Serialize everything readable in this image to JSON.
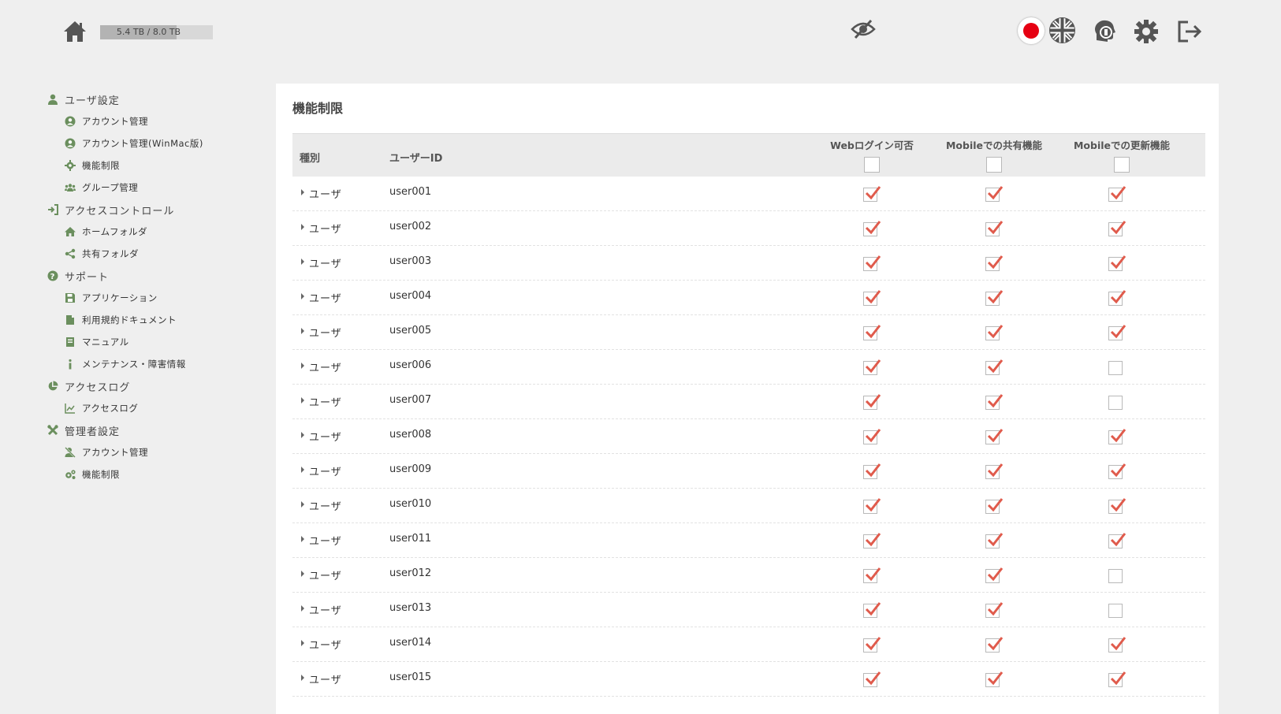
{
  "header": {
    "storage_text": "5.4 TB / 8.0 TB",
    "storage_used_fraction": 0.675,
    "icons": [
      "home-icon",
      "hidden-eye-icon",
      "japan-flag-icon",
      "uk-flag-icon",
      "support-icon",
      "gear-icon",
      "logout-icon"
    ]
  },
  "sidebar": {
    "sections": [
      {
        "label": "ユーザ設定",
        "icon": "user-icon",
        "items": [
          {
            "label": "アカウント管理",
            "icon": "account-icon"
          },
          {
            "label": "アカウント管理(WinMac版)",
            "icon": "account-icon"
          },
          {
            "label": "機能制限",
            "icon": "gear-icon"
          },
          {
            "label": "グループ管理",
            "icon": "group-icon"
          }
        ]
      },
      {
        "label": "アクセスコントロール",
        "icon": "sign-in-icon",
        "items": [
          {
            "label": "ホームフォルダ",
            "icon": "home-icon"
          },
          {
            "label": "共有フォルダ",
            "icon": "share-icon"
          }
        ]
      },
      {
        "label": "サポート",
        "icon": "question-icon",
        "items": [
          {
            "label": "アプリケーション",
            "icon": "save-icon"
          },
          {
            "label": "利用規約ドキュメント",
            "icon": "document-icon"
          },
          {
            "label": "マニュアル",
            "icon": "book-icon"
          },
          {
            "label": "メンテナンス・障害情報",
            "icon": "info-icon"
          }
        ]
      },
      {
        "label": "アクセスログ",
        "icon": "pie-chart-icon",
        "items": [
          {
            "label": "アクセスログ",
            "icon": "line-chart-icon"
          }
        ]
      },
      {
        "label": "管理者設定",
        "icon": "tools-icon",
        "items": [
          {
            "label": "アカウント管理",
            "icon": "user-slash-icon"
          },
          {
            "label": "機能制限",
            "icon": "gears-icon"
          }
        ]
      }
    ]
  },
  "main": {
    "title": "機能制限",
    "columns": {
      "type": "種別",
      "user_id": "ユーザーID",
      "web_login": "Webログイン可否",
      "mobile_share": "Mobileでの共有機能",
      "mobile_update": "Mobileでの更新機能"
    },
    "rows": [
      {
        "type": "ユーザ",
        "id": "user001",
        "web": true,
        "share": true,
        "update": true
      },
      {
        "type": "ユーザ",
        "id": "user002",
        "web": true,
        "share": true,
        "update": true
      },
      {
        "type": "ユーザ",
        "id": "user003",
        "web": true,
        "share": true,
        "update": true
      },
      {
        "type": "ユーザ",
        "id": "user004",
        "web": true,
        "share": true,
        "update": true
      },
      {
        "type": "ユーザ",
        "id": "user005",
        "web": true,
        "share": true,
        "update": true
      },
      {
        "type": "ユーザ",
        "id": "user006",
        "web": true,
        "share": true,
        "update": false
      },
      {
        "type": "ユーザ",
        "id": "user007",
        "web": true,
        "share": true,
        "update": false
      },
      {
        "type": "ユーザ",
        "id": "user008",
        "web": true,
        "share": true,
        "update": true
      },
      {
        "type": "ユーザ",
        "id": "user009",
        "web": true,
        "share": true,
        "update": true
      },
      {
        "type": "ユーザ",
        "id": "user010",
        "web": true,
        "share": true,
        "update": true
      },
      {
        "type": "ユーザ",
        "id": "user011",
        "web": true,
        "share": true,
        "update": true
      },
      {
        "type": "ユーザ",
        "id": "user012",
        "web": true,
        "share": true,
        "update": false
      },
      {
        "type": "ユーザ",
        "id": "user013",
        "web": true,
        "share": true,
        "update": false
      },
      {
        "type": "ユーザ",
        "id": "user014",
        "web": true,
        "share": true,
        "update": true
      },
      {
        "type": "ユーザ",
        "id": "user015",
        "web": true,
        "share": true,
        "update": true
      }
    ]
  },
  "colors": {
    "accent": "#6b8f5e",
    "check": "#e05b4c",
    "panel": "#ffffff",
    "background": "#efefef"
  }
}
